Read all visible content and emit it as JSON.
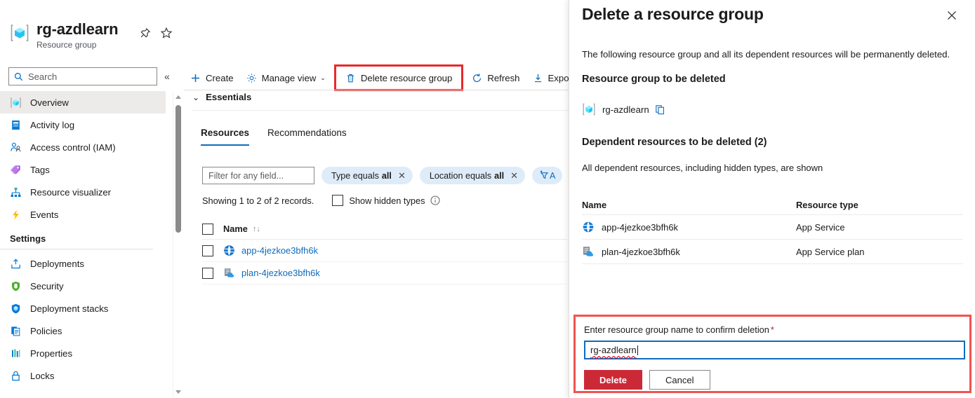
{
  "colors": {
    "accent": "#0f6cbd",
    "danger": "#cc2936",
    "highlight_border": "#e8292b",
    "confirm_border": "#f2534f",
    "chip_bg": "#deecf9",
    "selected_nav_bg": "#edebe9"
  },
  "resource_group": {
    "title": "rg-azdlearn",
    "subtitle": "Resource group",
    "icon": "resource-group-icon"
  },
  "header_actions": [
    {
      "name": "pin-icon",
      "label": "Pin"
    },
    {
      "name": "favorite-star-icon",
      "label": "Favorite"
    },
    {
      "name": "more-options-icon",
      "label": "…"
    }
  ],
  "sidebar": {
    "search": {
      "placeholder": "Search",
      "value": "",
      "icon": "search-icon"
    },
    "collapse": {
      "label": "«",
      "name": "collapse-sidebar-button"
    },
    "items": [
      {
        "label": "Overview",
        "icon": "overview-icon",
        "selected": true
      },
      {
        "label": "Activity log",
        "icon": "activity-log-icon",
        "selected": false
      },
      {
        "label": "Access control (IAM)",
        "icon": "access-control-icon",
        "selected": false
      },
      {
        "label": "Tags",
        "icon": "tags-icon",
        "selected": false
      },
      {
        "label": "Resource visualizer",
        "icon": "resource-visualizer-icon",
        "selected": false
      },
      {
        "label": "Events",
        "icon": "events-icon",
        "selected": false
      }
    ],
    "group_label": "Settings",
    "settings_items": [
      {
        "label": "Deployments",
        "icon": "deployments-icon"
      },
      {
        "label": "Security",
        "icon": "security-shield-icon"
      },
      {
        "label": "Deployment stacks",
        "icon": "deployment-stacks-icon"
      },
      {
        "label": "Policies",
        "icon": "policies-icon"
      },
      {
        "label": "Properties",
        "icon": "properties-icon"
      },
      {
        "label": "Locks",
        "icon": "locks-icon"
      }
    ]
  },
  "toolbar": {
    "create": {
      "label": "Create",
      "icon": "plus-icon"
    },
    "manage_view": {
      "label": "Manage view",
      "icon": "gear-icon",
      "caret": "⌄"
    },
    "delete_resource_group": {
      "label": "Delete resource group",
      "icon": "trash-icon",
      "highlighted": true
    },
    "refresh": {
      "label": "Refresh",
      "icon": "refresh-icon"
    },
    "export": {
      "label": "Export",
      "icon": "download-icon"
    }
  },
  "essentials": {
    "label": "Essentials",
    "chevron": "⌄"
  },
  "tabs": [
    {
      "label": "Resources",
      "active": true
    },
    {
      "label": "Recommendations",
      "active": false
    }
  ],
  "filters": {
    "field_placeholder": "Filter for any field...",
    "chips": [
      {
        "text": "Type equals",
        "value": "all",
        "close": "✕"
      },
      {
        "text": "Location equals",
        "value": "all",
        "close": "✕"
      }
    ],
    "add_filter": {
      "label": "A",
      "icon": "add-filter-icon"
    }
  },
  "records": {
    "text": "Showing 1 to 2 of 2 records.",
    "show_hidden_types": "Show hidden types",
    "checked": false,
    "info_icon": "info-icon"
  },
  "grid": {
    "header": {
      "name": "Name",
      "sort": "↑↓"
    },
    "rows": [
      {
        "name": "app-4jezkoe3bfh6k",
        "icon": "app-service-icon",
        "checked": false
      },
      {
        "name": "plan-4jezkoe3bfh6k",
        "icon": "app-service-plan-icon",
        "checked": false
      }
    ]
  },
  "panel": {
    "title": "Delete a resource group",
    "close_icon": "close-icon",
    "intro": "The following resource group and all its dependent resources will be permanently deleted.",
    "section1_title": "Resource group to be deleted",
    "rg_name": "rg-azdlearn",
    "copy_icon": "copy-icon",
    "section2_title": "Dependent resources to be deleted (2)",
    "note": "All dependent resources, including hidden types, are shown",
    "table": {
      "columns": [
        "Name",
        "Resource type"
      ],
      "rows": [
        {
          "name": "app-4jezkoe3bfh6k",
          "type": "App Service",
          "icon": "app-service-icon"
        },
        {
          "name": "plan-4jezkoe3bfh6k",
          "type": "App Service plan",
          "icon": "app-service-plan-icon"
        }
      ]
    },
    "confirm": {
      "label": "Enter resource group name to confirm deletion",
      "required_mark": "*",
      "input_value": "rg-azdlearn",
      "delete_label": "Delete",
      "cancel_label": "Cancel"
    }
  }
}
